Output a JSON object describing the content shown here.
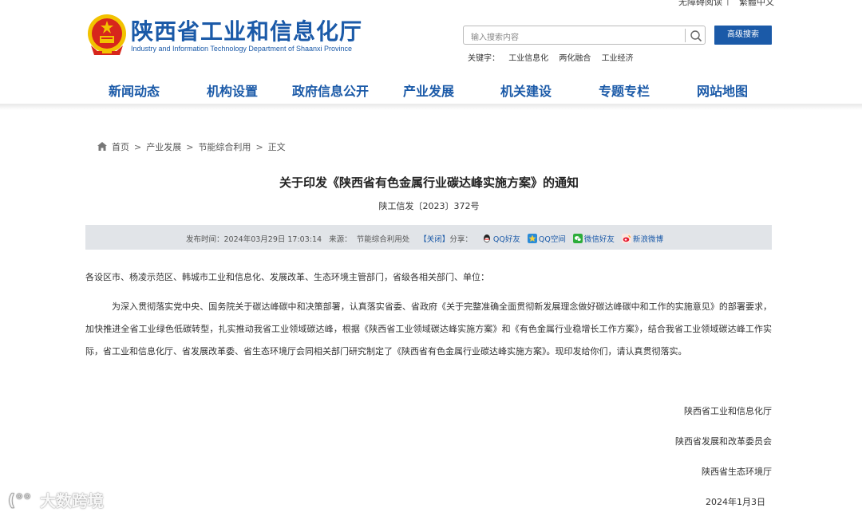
{
  "topbar": {
    "accessibility": "无障碍阅读",
    "separator": "|",
    "traditional": "繁體中文"
  },
  "header": {
    "title": "陕西省工业和信息化厅",
    "subtitle": "Industry and Information Technology Department of Shaanxi Province",
    "search_placeholder": "输入搜索内容",
    "advanced_search": "高级搜索",
    "keywords_label": "关键字：",
    "keywords": [
      "工业信息化",
      "两化融合",
      "工业经济"
    ]
  },
  "nav": [
    "新闻动态",
    "机构设置",
    "政府信息公开",
    "产业发展",
    "机关建设",
    "专题专栏",
    "网站地图"
  ],
  "breadcrumb": [
    "首页",
    "产业发展",
    "节能综合利用",
    "正文"
  ],
  "breadcrumb_sep": ">",
  "article": {
    "title": "关于印发《陕西省有色金属行业碳达峰实施方案》的通知",
    "doc_number": "陕工信发〔2023〕372号",
    "meta": {
      "publish_label": "发布时间：",
      "publish_time": "2024年03月29日 17:03:14",
      "source_label": "来源：",
      "source": "节能综合利用处",
      "close": "【关闭】",
      "share_label": "分享：",
      "share": [
        "QQ好友",
        "QQ空间",
        "微信好友",
        "新浪微博"
      ]
    },
    "recipients": "各设区市、杨凌示范区、韩城市工业和信息化、发展改革、生态环境主管部门，省级各相关部门、单位：",
    "paragraph": "为深入贯彻落实党中央、国务院关于碳达峰碳中和决策部署，认真落实省委、省政府《关于完整准确全面贯彻新发展理念做好碳达峰碳中和工作的实施意见》的部署要求，加快推进全省工业绿色低碳转型，扎实推动我省工业领域碳达峰，根据《陕西省工业领域碳达峰实施方案》和《有色金属行业稳增长工作方案》，结合我省工业领域碳达峰工作实际，省工业和信息化厅、省发展改革委、省生态环境厅会同相关部门研究制定了《陕西省有色金属行业碳达峰实施方案》。现印发给你们，请认真贯彻落实。",
    "signatures": [
      "陕西省工业和信息化厅",
      "陕西省发展和改革委员会",
      "陕西省生态环境厅"
    ],
    "date": "2024年1月3日"
  },
  "watermark": "大数跨境",
  "colors": {
    "brand": "#1b5aa8",
    "meta_bg": "#e1e4e8",
    "emblem_red": "#d7261c",
    "emblem_gold": "#f2c200"
  },
  "share_icons": [
    "qq-icon",
    "qzone-icon",
    "wechat-icon",
    "weibo-icon"
  ]
}
